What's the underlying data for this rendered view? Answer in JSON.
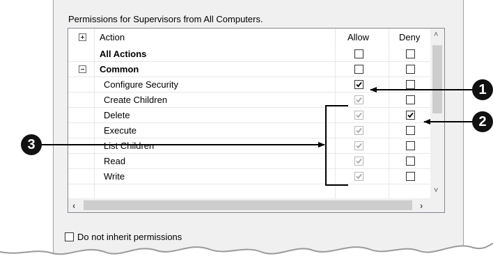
{
  "group_title": "Permissions for Supervisors from All Computers.",
  "columns": {
    "action": "Action",
    "allow": "Allow",
    "deny": "Deny"
  },
  "rows": [
    {
      "label": "All Actions",
      "bold": true,
      "indent": 0,
      "expander": "",
      "allow": "unchecked",
      "deny": "unchecked"
    },
    {
      "label": "Common",
      "bold": true,
      "indent": 1,
      "expander": "minus",
      "allow": "unchecked",
      "deny": "unchecked"
    },
    {
      "label": "Configure Security",
      "bold": false,
      "indent": 2,
      "expander": "",
      "allow": "checked",
      "deny": "unchecked"
    },
    {
      "label": "Create Children",
      "bold": false,
      "indent": 2,
      "expander": "",
      "allow": "inherited",
      "deny": "unchecked"
    },
    {
      "label": "Delete",
      "bold": false,
      "indent": 2,
      "expander": "",
      "allow": "inherited",
      "deny": "checked"
    },
    {
      "label": "Execute",
      "bold": false,
      "indent": 2,
      "expander": "",
      "allow": "inherited",
      "deny": "unchecked"
    },
    {
      "label": "List Children",
      "bold": false,
      "indent": 2,
      "expander": "",
      "allow": "inherited",
      "deny": "unchecked"
    },
    {
      "label": "Read",
      "bold": false,
      "indent": 2,
      "expander": "",
      "allow": "inherited",
      "deny": "unchecked"
    },
    {
      "label": "Write",
      "bold": false,
      "indent": 2,
      "expander": "",
      "allow": "inherited",
      "deny": "unchecked"
    }
  ],
  "inherit_checkbox": {
    "label": "Do not inherit permissions",
    "checked": false
  },
  "callouts": [
    "1",
    "2",
    "3"
  ],
  "colors": {
    "inherited_check": "#a8a8a8",
    "callout_bg": "#111111"
  }
}
